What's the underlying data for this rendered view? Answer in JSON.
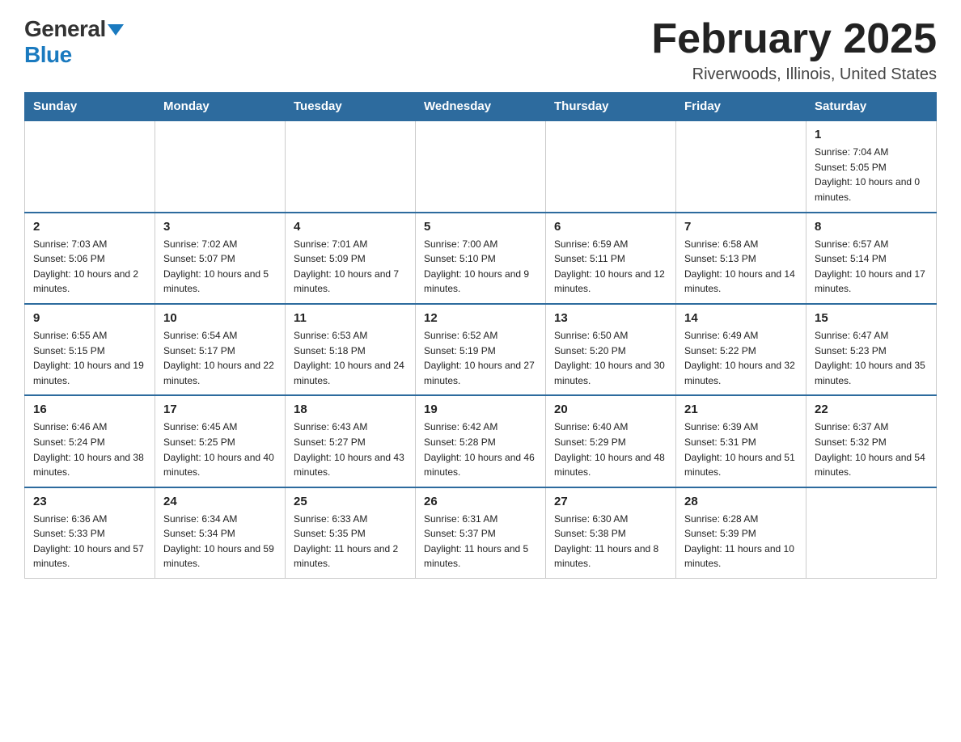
{
  "logo": {
    "general": "General",
    "blue": "Blue"
  },
  "header": {
    "title": "February 2025",
    "location": "Riverwoods, Illinois, United States"
  },
  "weekdays": [
    "Sunday",
    "Monday",
    "Tuesday",
    "Wednesday",
    "Thursday",
    "Friday",
    "Saturday"
  ],
  "weeks": [
    [
      {
        "day": "",
        "info": ""
      },
      {
        "day": "",
        "info": ""
      },
      {
        "day": "",
        "info": ""
      },
      {
        "day": "",
        "info": ""
      },
      {
        "day": "",
        "info": ""
      },
      {
        "day": "",
        "info": ""
      },
      {
        "day": "1",
        "info": "Sunrise: 7:04 AM\nSunset: 5:05 PM\nDaylight: 10 hours and 0 minutes."
      }
    ],
    [
      {
        "day": "2",
        "info": "Sunrise: 7:03 AM\nSunset: 5:06 PM\nDaylight: 10 hours and 2 minutes."
      },
      {
        "day": "3",
        "info": "Sunrise: 7:02 AM\nSunset: 5:07 PM\nDaylight: 10 hours and 5 minutes."
      },
      {
        "day": "4",
        "info": "Sunrise: 7:01 AM\nSunset: 5:09 PM\nDaylight: 10 hours and 7 minutes."
      },
      {
        "day": "5",
        "info": "Sunrise: 7:00 AM\nSunset: 5:10 PM\nDaylight: 10 hours and 9 minutes."
      },
      {
        "day": "6",
        "info": "Sunrise: 6:59 AM\nSunset: 5:11 PM\nDaylight: 10 hours and 12 minutes."
      },
      {
        "day": "7",
        "info": "Sunrise: 6:58 AM\nSunset: 5:13 PM\nDaylight: 10 hours and 14 minutes."
      },
      {
        "day": "8",
        "info": "Sunrise: 6:57 AM\nSunset: 5:14 PM\nDaylight: 10 hours and 17 minutes."
      }
    ],
    [
      {
        "day": "9",
        "info": "Sunrise: 6:55 AM\nSunset: 5:15 PM\nDaylight: 10 hours and 19 minutes."
      },
      {
        "day": "10",
        "info": "Sunrise: 6:54 AM\nSunset: 5:17 PM\nDaylight: 10 hours and 22 minutes."
      },
      {
        "day": "11",
        "info": "Sunrise: 6:53 AM\nSunset: 5:18 PM\nDaylight: 10 hours and 24 minutes."
      },
      {
        "day": "12",
        "info": "Sunrise: 6:52 AM\nSunset: 5:19 PM\nDaylight: 10 hours and 27 minutes."
      },
      {
        "day": "13",
        "info": "Sunrise: 6:50 AM\nSunset: 5:20 PM\nDaylight: 10 hours and 30 minutes."
      },
      {
        "day": "14",
        "info": "Sunrise: 6:49 AM\nSunset: 5:22 PM\nDaylight: 10 hours and 32 minutes."
      },
      {
        "day": "15",
        "info": "Sunrise: 6:47 AM\nSunset: 5:23 PM\nDaylight: 10 hours and 35 minutes."
      }
    ],
    [
      {
        "day": "16",
        "info": "Sunrise: 6:46 AM\nSunset: 5:24 PM\nDaylight: 10 hours and 38 minutes."
      },
      {
        "day": "17",
        "info": "Sunrise: 6:45 AM\nSunset: 5:25 PM\nDaylight: 10 hours and 40 minutes."
      },
      {
        "day": "18",
        "info": "Sunrise: 6:43 AM\nSunset: 5:27 PM\nDaylight: 10 hours and 43 minutes."
      },
      {
        "day": "19",
        "info": "Sunrise: 6:42 AM\nSunset: 5:28 PM\nDaylight: 10 hours and 46 minutes."
      },
      {
        "day": "20",
        "info": "Sunrise: 6:40 AM\nSunset: 5:29 PM\nDaylight: 10 hours and 48 minutes."
      },
      {
        "day": "21",
        "info": "Sunrise: 6:39 AM\nSunset: 5:31 PM\nDaylight: 10 hours and 51 minutes."
      },
      {
        "day": "22",
        "info": "Sunrise: 6:37 AM\nSunset: 5:32 PM\nDaylight: 10 hours and 54 minutes."
      }
    ],
    [
      {
        "day": "23",
        "info": "Sunrise: 6:36 AM\nSunset: 5:33 PM\nDaylight: 10 hours and 57 minutes."
      },
      {
        "day": "24",
        "info": "Sunrise: 6:34 AM\nSunset: 5:34 PM\nDaylight: 10 hours and 59 minutes."
      },
      {
        "day": "25",
        "info": "Sunrise: 6:33 AM\nSunset: 5:35 PM\nDaylight: 11 hours and 2 minutes."
      },
      {
        "day": "26",
        "info": "Sunrise: 6:31 AM\nSunset: 5:37 PM\nDaylight: 11 hours and 5 minutes."
      },
      {
        "day": "27",
        "info": "Sunrise: 6:30 AM\nSunset: 5:38 PM\nDaylight: 11 hours and 8 minutes."
      },
      {
        "day": "28",
        "info": "Sunrise: 6:28 AM\nSunset: 5:39 PM\nDaylight: 11 hours and 10 minutes."
      },
      {
        "day": "",
        "info": ""
      }
    ]
  ]
}
